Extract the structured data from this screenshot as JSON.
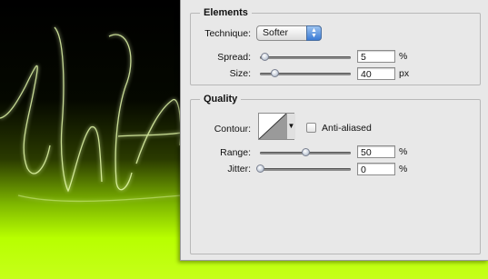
{
  "elements": {
    "legend": "Elements",
    "technique_label": "Technique:",
    "technique_value": "Softer",
    "spread_label": "Spread:",
    "spread_value": "5",
    "spread_unit": "%",
    "spread_level": 0.05,
    "size_label": "Size:",
    "size_value": "40",
    "size_unit": "px",
    "size_level": 0.16
  },
  "quality": {
    "legend": "Quality",
    "contour_label": "Contour:",
    "anti_aliased_label": "Anti-aliased",
    "anti_aliased_checked": false,
    "range_label": "Range:",
    "range_value": "50",
    "range_unit": "%",
    "range_level": 0.5,
    "jitter_label": "Jitter:",
    "jitter_value": "0",
    "jitter_unit": "%",
    "jitter_level": 0.0
  },
  "colors": {
    "glow": "#c6ff1a",
    "panel": "#e8e8e8",
    "accent": "#3a7bd5"
  }
}
